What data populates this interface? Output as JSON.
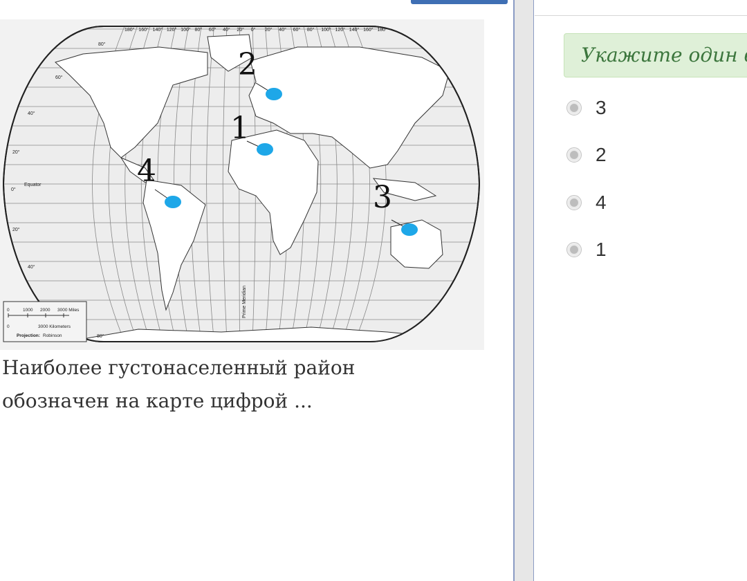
{
  "question": {
    "text": "Наиболее густонаселенный район обозначен на карте цифрой ...",
    "map": {
      "longitude_labels": [
        "180°",
        "160°",
        "140°",
        "120°",
        "100°",
        "80°",
        "60°",
        "40°",
        "20°",
        "0°",
        "20°",
        "40°",
        "60°",
        "80°",
        "100°",
        "120°",
        "140°",
        "160°",
        "180°"
      ],
      "latitude_labels": [
        "80°",
        "60°",
        "40°",
        "20°",
        "0°",
        "20°",
        "40°",
        "80°"
      ],
      "equator_label": "Equator",
      "meridian_label": "Prime Meridian",
      "scale": {
        "miles_ticks": [
          "0",
          "1000",
          "2000",
          "3000 Miles"
        ],
        "km_ticks": [
          "0",
          "3000 Kilometers"
        ],
        "projection_key": "Projection:",
        "projection_value": "Robinson"
      },
      "markers": [
        {
          "number": "1",
          "region": "Africa (Sahara)"
        },
        {
          "number": "2",
          "region": "Europe"
        },
        {
          "number": "3",
          "region": "Australia"
        },
        {
          "number": "4",
          "region": "South America (Amazon)"
        }
      ],
      "marker_color": "#1ea7e8"
    }
  },
  "answer_panel": {
    "instruction": "Укажите один вариант ответа",
    "options": [
      {
        "label": "3",
        "selected": false
      },
      {
        "label": "2",
        "selected": false
      },
      {
        "label": "4",
        "selected": false
      },
      {
        "label": "1",
        "selected": false
      }
    ],
    "accent_color": "#3c763d",
    "instruction_bg": "#dff0d8"
  }
}
